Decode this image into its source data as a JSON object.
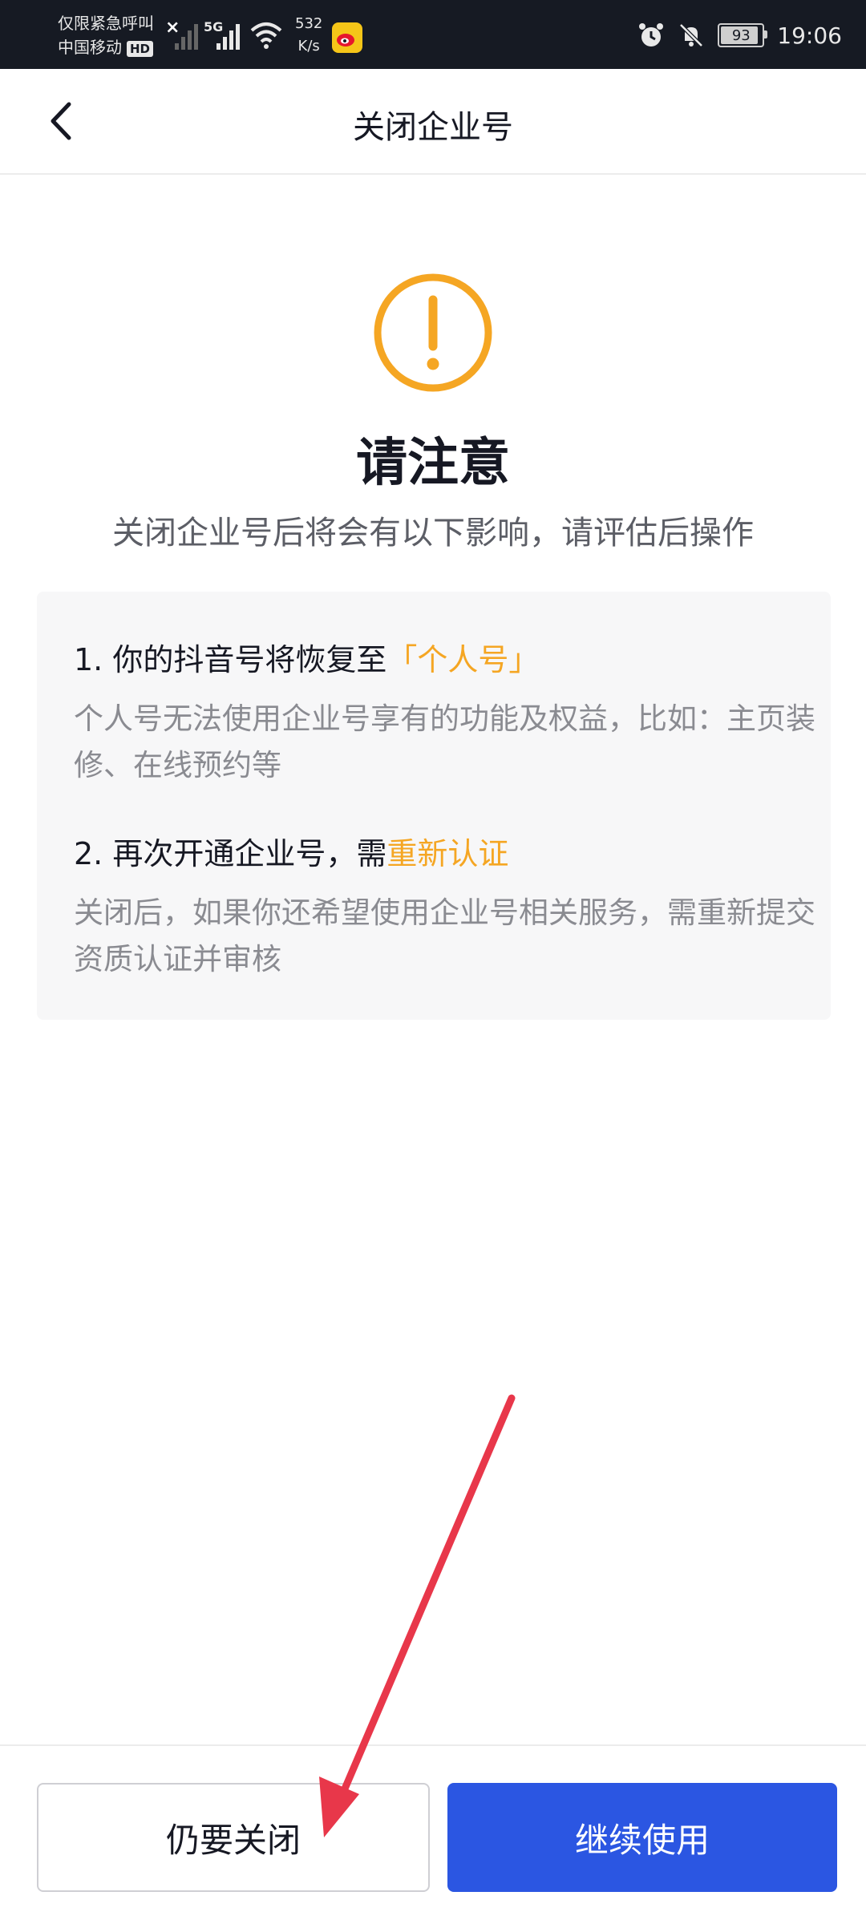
{
  "status_bar": {
    "carrier_line1": "仅限紧急呼叫",
    "carrier_line2": "中国移动",
    "hd_badge": "HD",
    "network": "5G",
    "speed_value": "532",
    "speed_unit": "K/s",
    "battery": "93",
    "time": "19:06"
  },
  "nav": {
    "title": "关闭企业号"
  },
  "notice": {
    "heading": "请注意",
    "subtitle": "关闭企业号后将会有以下影响，请评估后操作",
    "items": [
      {
        "title_prefix": "1. 你的抖音号将恢复至",
        "title_highlight": "「个人号」",
        "desc": "个人号无法使用企业号享有的功能及权益，比如：主页装修、在线预约等"
      },
      {
        "title_prefix": "2. 再次开通企业号，需",
        "title_highlight": "重新认证",
        "desc": "关闭后，如果你还希望使用企业号相关服务，需重新提交资质认证并审核"
      }
    ]
  },
  "actions": {
    "close_label": "仍要关闭",
    "continue_label": "继续使用"
  },
  "colors": {
    "accent_orange": "#f5a623",
    "primary_blue": "#2b56e2",
    "annotation_red": "#e8374a"
  }
}
